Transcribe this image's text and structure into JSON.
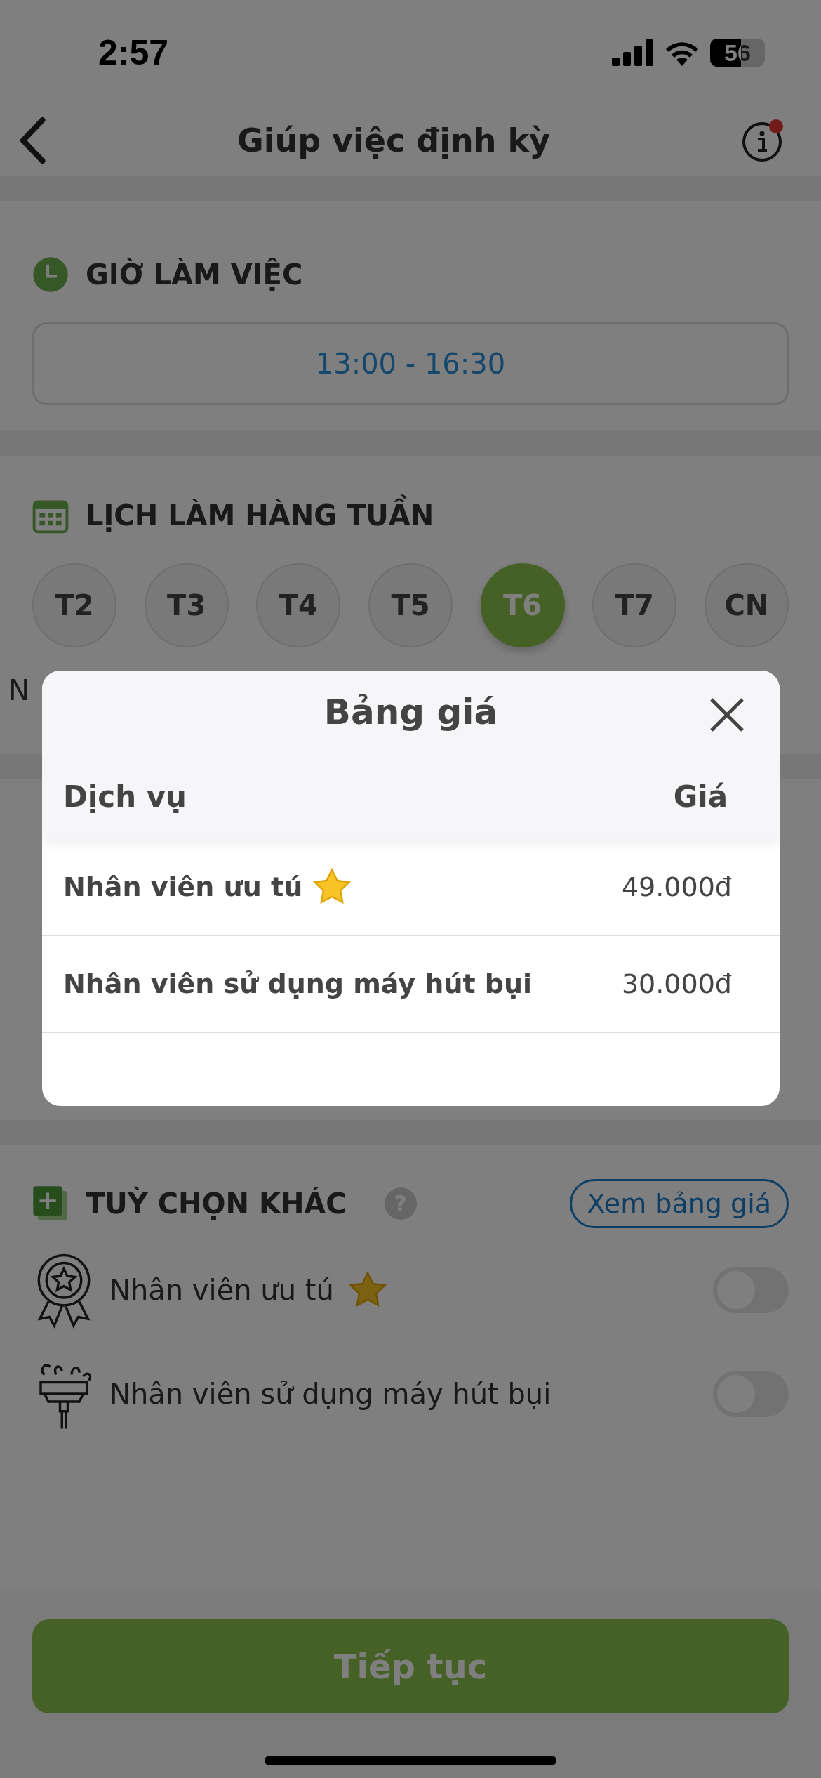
{
  "status_bar": {
    "time": "2:57",
    "battery": "56"
  },
  "header": {
    "title": "Giúp việc định kỳ",
    "info_badge": true
  },
  "working_hours": {
    "title": "GIỜ LÀM VIỆC",
    "value": "13:00 - 16:30"
  },
  "weekly_schedule": {
    "title": "LỊCH LÀM HÀNG TUẦN",
    "days": [
      {
        "label": "T2",
        "selected": false
      },
      {
        "label": "T3",
        "selected": false
      },
      {
        "label": "T4",
        "selected": false
      },
      {
        "label": "T5",
        "selected": false
      },
      {
        "label": "T6",
        "selected": true
      },
      {
        "label": "T7",
        "selected": false
      },
      {
        "label": "CN",
        "selected": false
      }
    ],
    "note": "N"
  },
  "other_options": {
    "title": "TUỲ CHỌN KHÁC",
    "help": "?",
    "price_button": "Xem bảng giá",
    "options": [
      {
        "kind": "award",
        "label": "Nhân viên ưu tú",
        "star": true,
        "on": false
      },
      {
        "kind": "vacuum",
        "label": "Nhân viên sử dụng máy hút bụi",
        "star": false,
        "on": false
      }
    ]
  },
  "continue_button": "Tiếp tục",
  "price_dialog": {
    "title": "Bảng giá",
    "columns": [
      "Dịch vụ",
      "Giá"
    ],
    "rows": [
      {
        "service": "Nhân viên ưu tú",
        "star": true,
        "price": "49.000đ"
      },
      {
        "service": "Nhân viên sử dụng máy hút bụi",
        "star": false,
        "price": "30.000đ"
      }
    ]
  }
}
